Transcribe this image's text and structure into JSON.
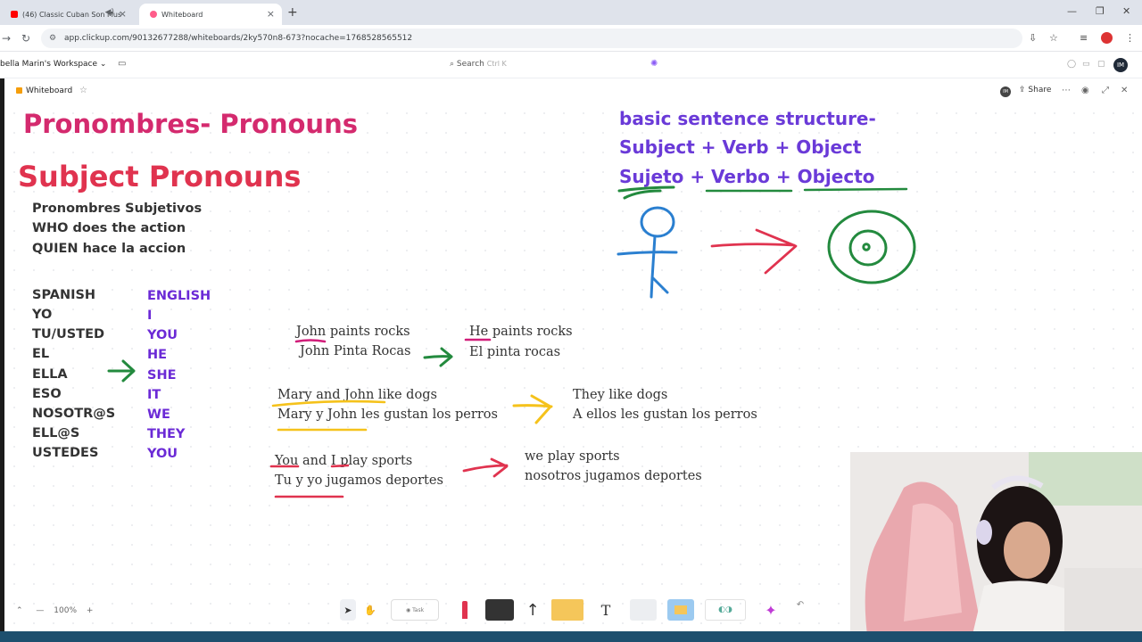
{
  "browser": {
    "tabs": [
      {
        "label": "(46) Classic Cuban Son Mus",
        "active": false
      },
      {
        "label": "Whiteboard",
        "active": true
      }
    ],
    "url": "app.clickup.com/90132677288/whiteboards/2ky570n8-673?nocache=1768528565512"
  },
  "clickup": {
    "workspace": "bella Marin's Workspace",
    "search_label": "Search",
    "search_shortcut": "Ctrl K",
    "user_initials": "IM",
    "whiteboard_title": "Whiteboard",
    "share_label": "Share",
    "zoom_level": "100%",
    "task_label": "Task"
  },
  "whiteboard": {
    "title": "Pronombres- Pronouns",
    "subtitle": "Subject Pronouns",
    "definition": [
      "Pronombres Subjetivos",
      "WHO does the action",
      "QUIEN hace la accion"
    ],
    "spanish_header": "SPANISH",
    "english_header": "ENGLISH",
    "spanish": [
      "YO",
      "TU/USTED",
      "EL",
      "ELLA",
      "ESO",
      "NOSOTR@S",
      "ELL@S",
      "USTEDES"
    ],
    "english": [
      "I",
      "YOU",
      "HE",
      "SHE",
      "IT",
      "WE",
      "THEY",
      "YOU"
    ],
    "structure": [
      "basic sentence structure-",
      "Subject + Verb + Object",
      "Sujeto + Verbo + Objecto"
    ],
    "examples": [
      {
        "en": "John paints rocks",
        "es": "John Pinta Rocas",
        "en_result": "He paints rocks",
        "es_result": "El pinta rocas"
      },
      {
        "en": "Mary and John like dogs",
        "es": "Mary y John les gustan los perros",
        "en_result": "They like dogs",
        "es_result": "A ellos les gustan los perros"
      },
      {
        "en": "You and I play sports",
        "es": "Tu y yo jugamos deportes",
        "en_result": "we play sports",
        "es_result": "nosotros jugamos deportes"
      }
    ]
  },
  "colors": {
    "title_pink": "#d42a6e",
    "subtitle_red": "#e0334f",
    "english_purple": "#6b2ad6",
    "structure_purple": "#6a3ad8",
    "ink_green": "#238a3e",
    "ink_red": "#e0334f",
    "ink_blue": "#2a7fd0",
    "ink_yellow": "#f5c21b",
    "ink_magenta": "#d11e7a"
  }
}
